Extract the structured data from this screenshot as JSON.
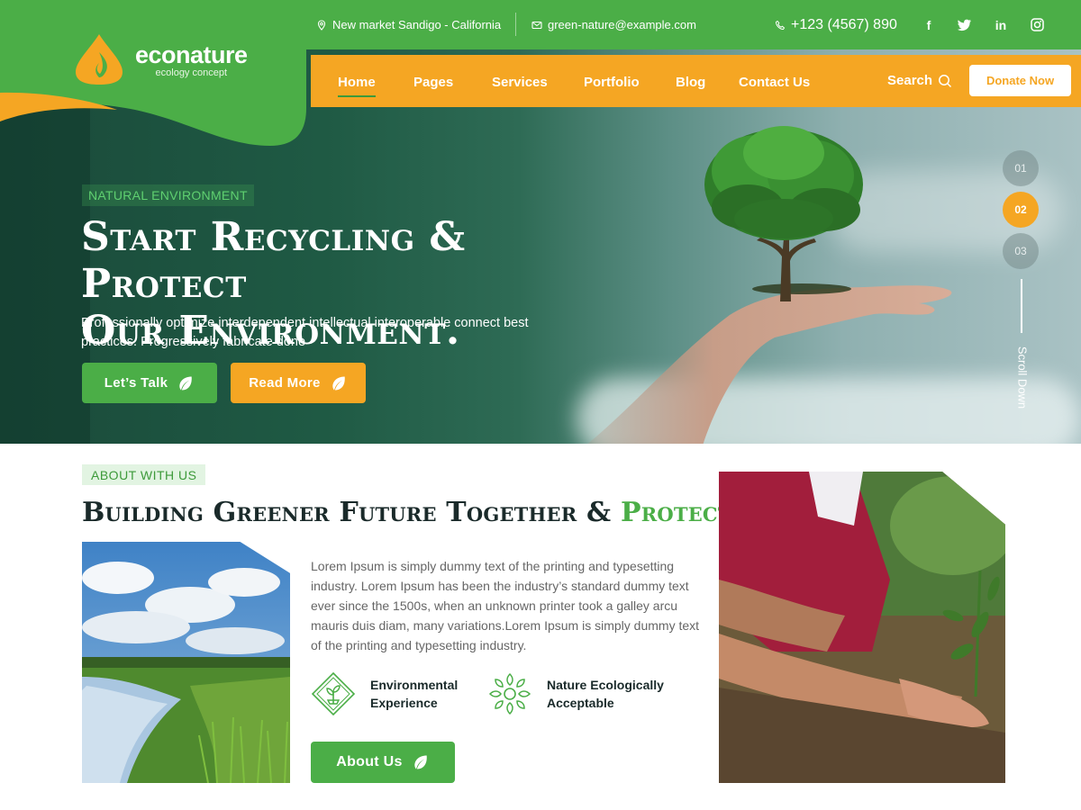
{
  "brand": {
    "name": "econature",
    "tagline": "ecology concept"
  },
  "topbar": {
    "address": "New market Sandigo - California",
    "email": "green-nature@example.com",
    "phone": "+123 (4567) 890",
    "social": [
      "facebook-icon",
      "twitter-icon",
      "linkedin-icon",
      "instagram-icon"
    ]
  },
  "nav": {
    "items": [
      {
        "label": "Home",
        "active": true
      },
      {
        "label": "Pages"
      },
      {
        "label": "Services"
      },
      {
        "label": "Portfolio"
      },
      {
        "label": "Blog"
      },
      {
        "label": "Contact Us"
      }
    ],
    "search_label": "Search",
    "donate_label": "Donate Now"
  },
  "hero": {
    "badge": "NATURAL ENVIRONMENT",
    "title_line1": "Start Recycling & Protect",
    "title_line2": "Our Environment.",
    "description": "Professionally optimize interdependent intellectual interoperable connect best practices. Progressively fabricate done",
    "btn_talk": "Let’s Talk",
    "btn_read": "Read More",
    "slides": [
      "01",
      "02",
      "03"
    ],
    "active_slide": "02",
    "scroll_label": "Scroll Down"
  },
  "about": {
    "badge": "ABOUT WITH US",
    "title_main": "Building Greener Future Together &",
    "title_accent": "Protect.",
    "text": "Lorem Ipsum is simply dummy text of the printing and typesetting industry. Lorem Ipsum has been the industry’s standard dummy text ever since the 1500s, when an unknown printer took a galley arcu mauris duis diam, many variations.Lorem Ipsum is simply dummy text of the printing and typesetting industry.",
    "features": [
      {
        "icon": "plant-diamond-icon",
        "line1": "Environmental",
        "line2": "Experience"
      },
      {
        "icon": "leaf-wreath-icon",
        "line1": "Nature Ecologically",
        "line2": "Acceptable"
      }
    ],
    "btn_about": "About Us"
  },
  "colors": {
    "green": "#4bae47",
    "orange": "#f5a623",
    "dark_green": "#1a4a3a"
  }
}
